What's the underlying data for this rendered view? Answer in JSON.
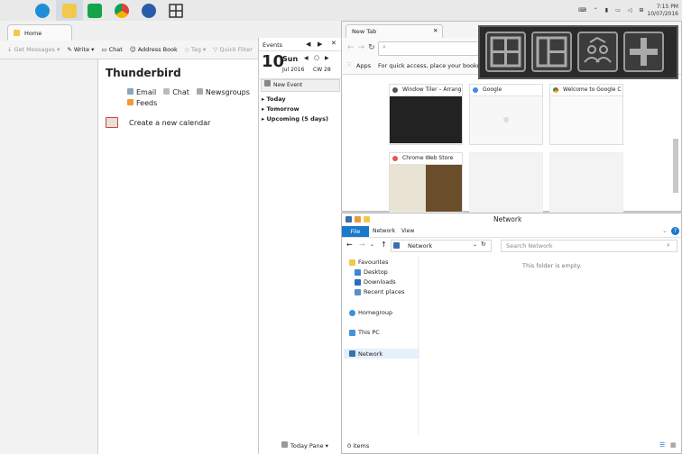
{
  "taskbar": {
    "apps": [
      "internet-explorer",
      "file-explorer",
      "store",
      "chrome",
      "thunderbird",
      "window-tiler"
    ],
    "clock_time": "7:15 PM",
    "clock_date": "10/07/2016"
  },
  "thunderbird": {
    "tab_home": "Home",
    "toolbar": {
      "get_messages": "Get Messages",
      "write": "Write",
      "chat": "Chat",
      "address_book": "Address Book",
      "tag": "Tag",
      "quick_filter": "Quick Filter"
    },
    "title": "Thunderbird",
    "links": {
      "email": "Email",
      "chat": "Chat",
      "newsgroups": "Newsgroups",
      "feeds": "Feeds",
      "calendar": "Create a new calendar"
    },
    "events": {
      "label": "Events",
      "day": "10",
      "weekday": "Sun",
      "month_year": "Jul 2016",
      "cw": "CW 28",
      "new_event": "New Event",
      "today": "Today",
      "tomorrow": "Tomorrow",
      "upcoming": "Upcoming (5 days)"
    },
    "today_pane": "Today Pane"
  },
  "chrome": {
    "tab_title": "New Tab",
    "apps": "Apps",
    "bookmarks_hint": "For quick access, place your bookmarks h",
    "tiles": [
      "Window Tiler – Arrang",
      "Google",
      "Welcome to Google C",
      "Chrome Web Store"
    ]
  },
  "explorer": {
    "title": "Network",
    "tabs": {
      "file": "File",
      "network": "Network",
      "view": "View"
    },
    "address": "Network",
    "search_placeholder": "Search Network",
    "nav": [
      "Favourites",
      "Desktop",
      "Downloads",
      "Recent places",
      "Homegroup",
      "This PC",
      "Network"
    ],
    "empty": "This folder is empty.",
    "status": "0 items"
  },
  "colors": {
    "accent": "#1979ca",
    "tiler_bg": "#2a2a2a"
  }
}
